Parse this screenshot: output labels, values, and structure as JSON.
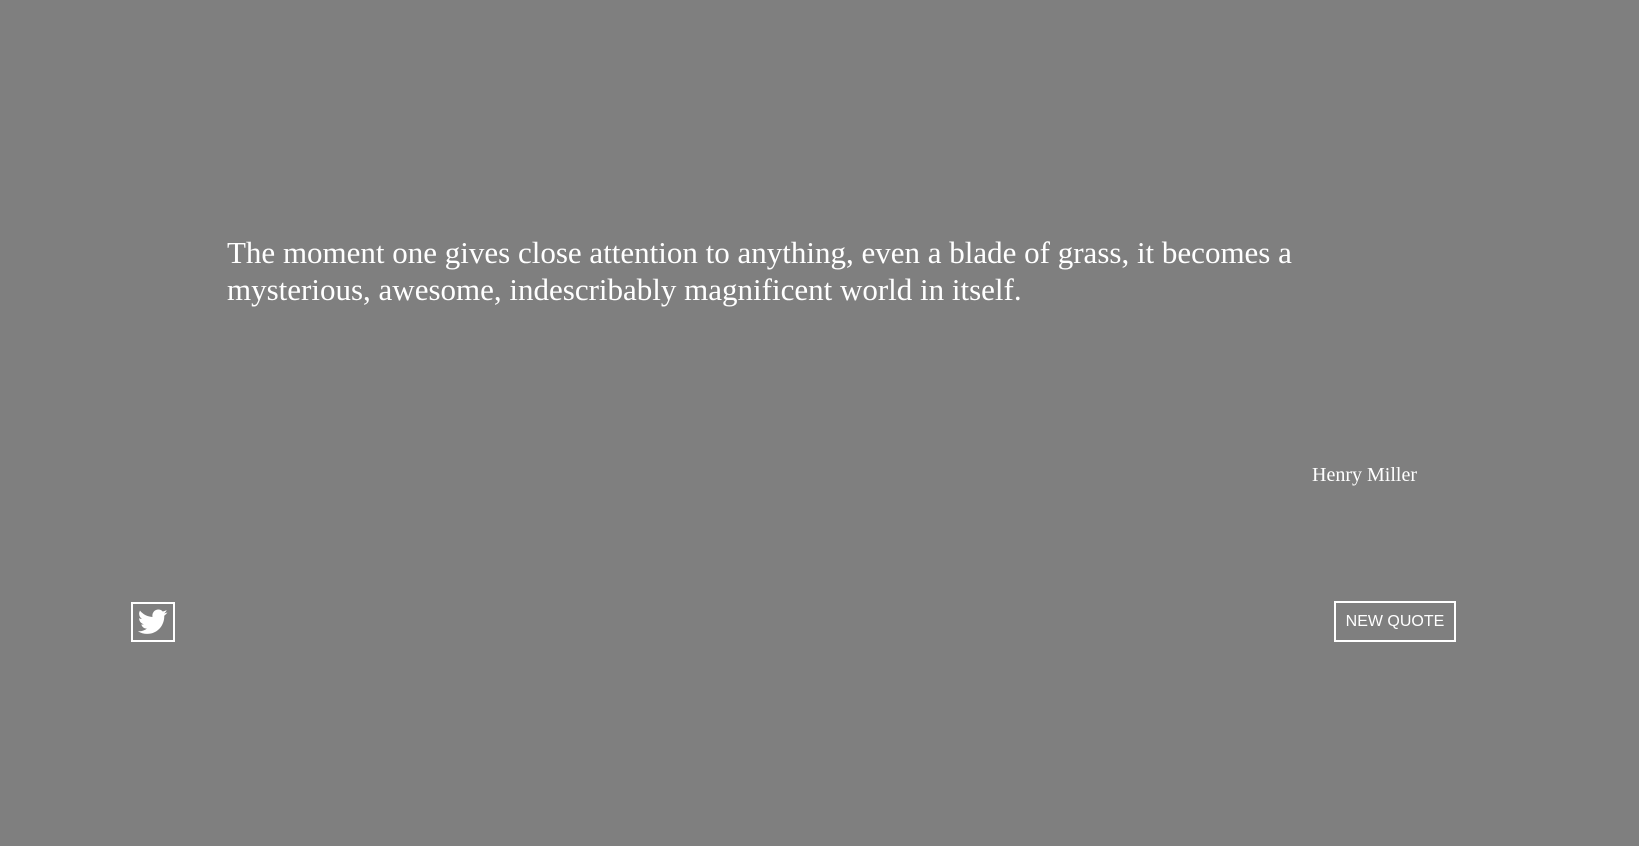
{
  "colors": {
    "background": "#7f7f7f",
    "foreground": "#ffffff"
  },
  "quote": {
    "text": "The moment one gives close attention to anything, even a blade of grass, it becomes a mysterious, awesome, indescribably magnificent world in itself.",
    "author": "Henry Miller"
  },
  "actions": {
    "tweet_icon": "twitter-icon",
    "new_quote_label": "NEW QUOTE"
  }
}
